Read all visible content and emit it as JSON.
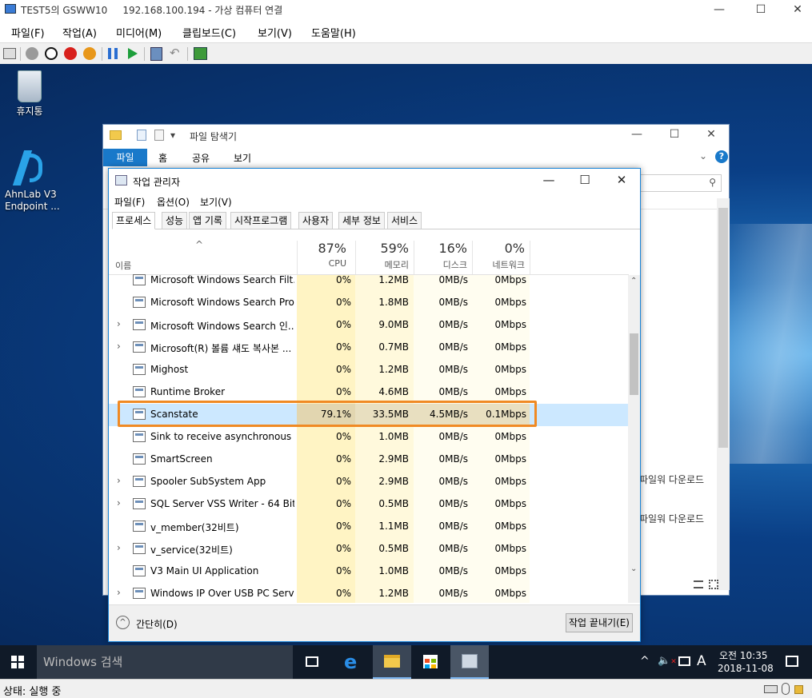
{
  "vm": {
    "title": "TEST5의 GSWW10     192.168.100.194 - 가상 컴퓨터 연결",
    "menu": [
      "파일(F)",
      "작업(A)",
      "미디어(M)",
      "클립보드(C)",
      "보기(V)",
      "도움말(H)"
    ],
    "status": "상태: 실행 중"
  },
  "desktop": {
    "icons": [
      {
        "label": "휴지통",
        "icon": "recycle-bin-icon"
      },
      {
        "label": "AhnLab V3\nEndpoint ...",
        "icon": "ahnlab-v3-icon"
      }
    ]
  },
  "explorer": {
    "title": "파일 탐색기",
    "ribbon_tabs": [
      "파일",
      "홈",
      "공유",
      "보기"
    ],
    "download_texts": [
      "파일워 다운로드",
      "파일워 다운로드"
    ]
  },
  "taskmgr": {
    "title": "작업 관리자",
    "menu": [
      "파일(F)",
      "옵션(O)",
      "보기(V)"
    ],
    "tabs": [
      "프로세스",
      "성능",
      "앱 기록",
      "시작프로그램",
      "사용자",
      "세부 정보",
      "서비스"
    ],
    "name_header": "이름",
    "columns": [
      {
        "pct": "87%",
        "label": "CPU"
      },
      {
        "pct": "59%",
        "label": "메모리"
      },
      {
        "pct": "16%",
        "label": "디스크"
      },
      {
        "pct": "0%",
        "label": "네트워크"
      }
    ],
    "rows": [
      {
        "name": "Microsoft Windows Search Filt...",
        "cpu": "0%",
        "mem": "1.2MB",
        "disk": "0MB/s",
        "net": "0Mbps",
        "expand": false
      },
      {
        "name": "Microsoft Windows Search Pro...",
        "cpu": "0%",
        "mem": "1.8MB",
        "disk": "0MB/s",
        "net": "0Mbps",
        "expand": false
      },
      {
        "name": "Microsoft Windows Search 인...",
        "cpu": "0%",
        "mem": "9.0MB",
        "disk": "0MB/s",
        "net": "0Mbps",
        "expand": true
      },
      {
        "name": "Microsoft(R) 볼륨 섀도 복사본 ...",
        "cpu": "0%",
        "mem": "0.7MB",
        "disk": "0MB/s",
        "net": "0Mbps",
        "expand": true
      },
      {
        "name": "Mighost",
        "cpu": "0%",
        "mem": "1.2MB",
        "disk": "0MB/s",
        "net": "0Mbps",
        "expand": false
      },
      {
        "name": "Runtime Broker",
        "cpu": "0%",
        "mem": "4.6MB",
        "disk": "0MB/s",
        "net": "0Mbps",
        "expand": false
      },
      {
        "name": "Scanstate",
        "cpu": "79.1%",
        "mem": "33.5MB",
        "disk": "4.5MB/s",
        "net": "0.1Mbps",
        "expand": false,
        "highlight": true
      },
      {
        "name": "Sink to receive asynchronous c...",
        "cpu": "0%",
        "mem": "1.0MB",
        "disk": "0MB/s",
        "net": "0Mbps",
        "expand": false
      },
      {
        "name": "SmartScreen",
        "cpu": "0%",
        "mem": "2.9MB",
        "disk": "0MB/s",
        "net": "0Mbps",
        "expand": false
      },
      {
        "name": "Spooler SubSystem App",
        "cpu": "0%",
        "mem": "2.9MB",
        "disk": "0MB/s",
        "net": "0Mbps",
        "expand": true
      },
      {
        "name": "SQL Server VSS Writer - 64 Bit",
        "cpu": "0%",
        "mem": "0.5MB",
        "disk": "0MB/s",
        "net": "0Mbps",
        "expand": true
      },
      {
        "name": "v_member(32비트)",
        "cpu": "0%",
        "mem": "1.1MB",
        "disk": "0MB/s",
        "net": "0Mbps",
        "expand": false
      },
      {
        "name": "v_service(32비트)",
        "cpu": "0%",
        "mem": "0.5MB",
        "disk": "0MB/s",
        "net": "0Mbps",
        "expand": true
      },
      {
        "name": "V3 Main UI Application",
        "cpu": "0%",
        "mem": "1.0MB",
        "disk": "0MB/s",
        "net": "0Mbps",
        "expand": false
      },
      {
        "name": "Windows IP Over USB PC Servi...",
        "cpu": "0%",
        "mem": "1.2MB",
        "disk": "0MB/s",
        "net": "0Mbps",
        "expand": true
      }
    ],
    "fewer_details": "간단히(D)",
    "end_task": "작업 끝내기(E)"
  },
  "taskbar": {
    "search_placeholder": "Windows 검색",
    "time": "오전 10:35",
    "date": "2018-11-08",
    "ime": "A"
  },
  "colors": {
    "accent": "#1979ca",
    "highlight_border": "#f08a24",
    "cpu_bg": "#fff4c4",
    "mem_bg": "#fff9dc"
  }
}
